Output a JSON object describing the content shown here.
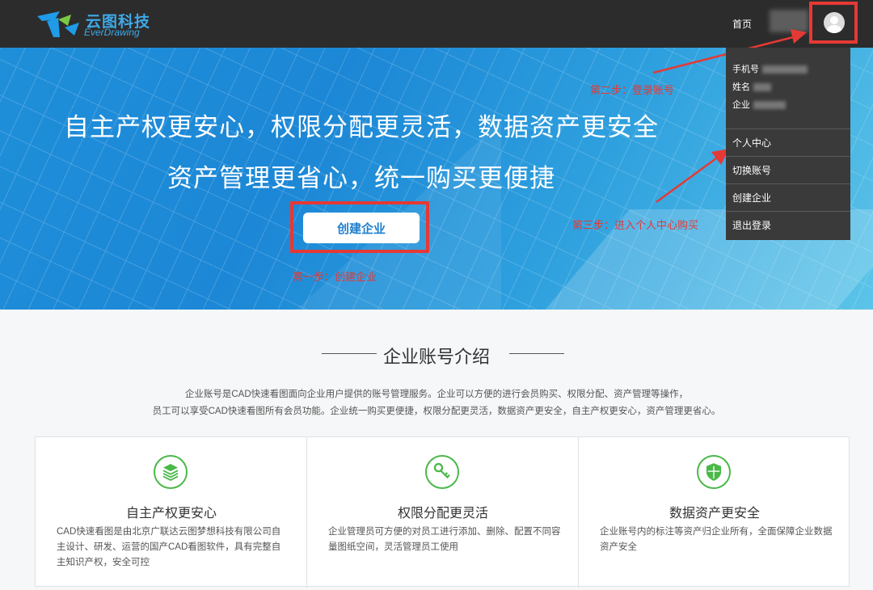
{
  "header": {
    "logo_cn": "云图科技",
    "logo_en": "EverDrawing",
    "nav_home": "首页"
  },
  "hero": {
    "title_line1": "自主产权更安心，权限分配更灵活，数据资产更安全",
    "title_line2": "资产管理更省心，统一购买更便捷",
    "create_button": "创建企业",
    "step1": "第一步：创建企业",
    "step2": "第二步：登录账号",
    "step3": "第三步：进入个人中心购买"
  },
  "dropdown": {
    "phone_label": "手机号",
    "name_label": "姓名",
    "company_label": "企业",
    "items": [
      {
        "label": "个人中心"
      },
      {
        "label": "切换账号"
      },
      {
        "label": "创建企业"
      },
      {
        "label": "退出登录"
      }
    ]
  },
  "intro": {
    "title": "企业账号介绍",
    "line1": "企业账号是CAD快速看图面向企业用户提供的账号管理服务。企业可以方便的进行会员购买、权限分配、资产管理等操作，",
    "line2": "员工可以享受CAD快速看图所有会员功能。企业统一购买更便捷，权限分配更灵活，数据资产更安全，自主产权更安心，资产管理更省心。"
  },
  "cards": [
    {
      "icon": "layers-icon",
      "title": "自主产权更安心",
      "desc": "CAD快速看图是由北京广联达云图梦想科技有限公司自主设计、研发、运营的国产CAD看图软件，具有完整自主知识产权，安全可控"
    },
    {
      "icon": "key-icon",
      "title": "权限分配更灵活",
      "desc": "企业管理员可方便的对员工进行添加、删除、配置不同容量图纸空间，灵活管理员工使用"
    },
    {
      "icon": "shield-icon",
      "title": "数据资产更安全",
      "desc": "企业账号内的标注等资产归企业所有，全面保障企业数据资产安全"
    }
  ],
  "colors": {
    "accent_green": "#4bb84a",
    "annotation_red": "#e53935",
    "brand_blue": "#1c7fd0"
  }
}
